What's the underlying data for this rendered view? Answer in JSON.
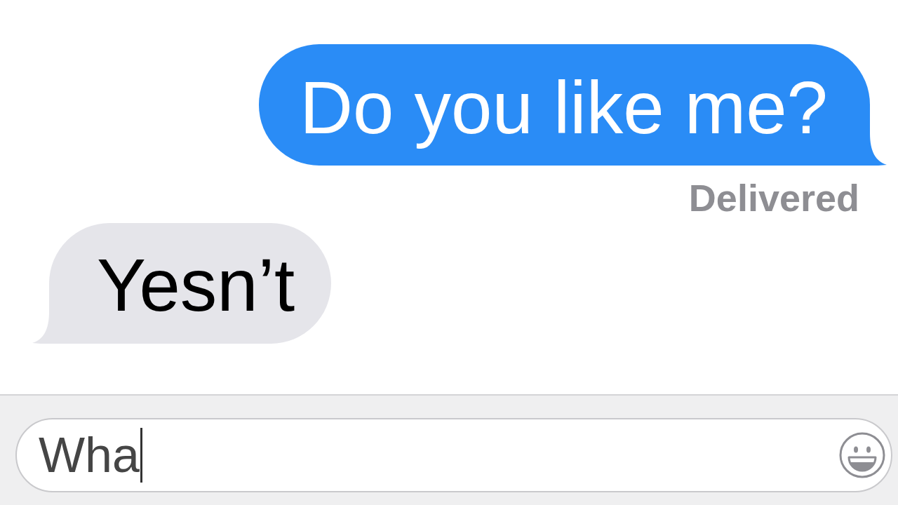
{
  "messages": [
    {
      "kind": "sent",
      "text": "Do you like me?",
      "status": "Delivered"
    },
    {
      "kind": "received",
      "text": "Yesn’t"
    }
  ],
  "composer": {
    "value": "Wha",
    "focused": true
  }
}
